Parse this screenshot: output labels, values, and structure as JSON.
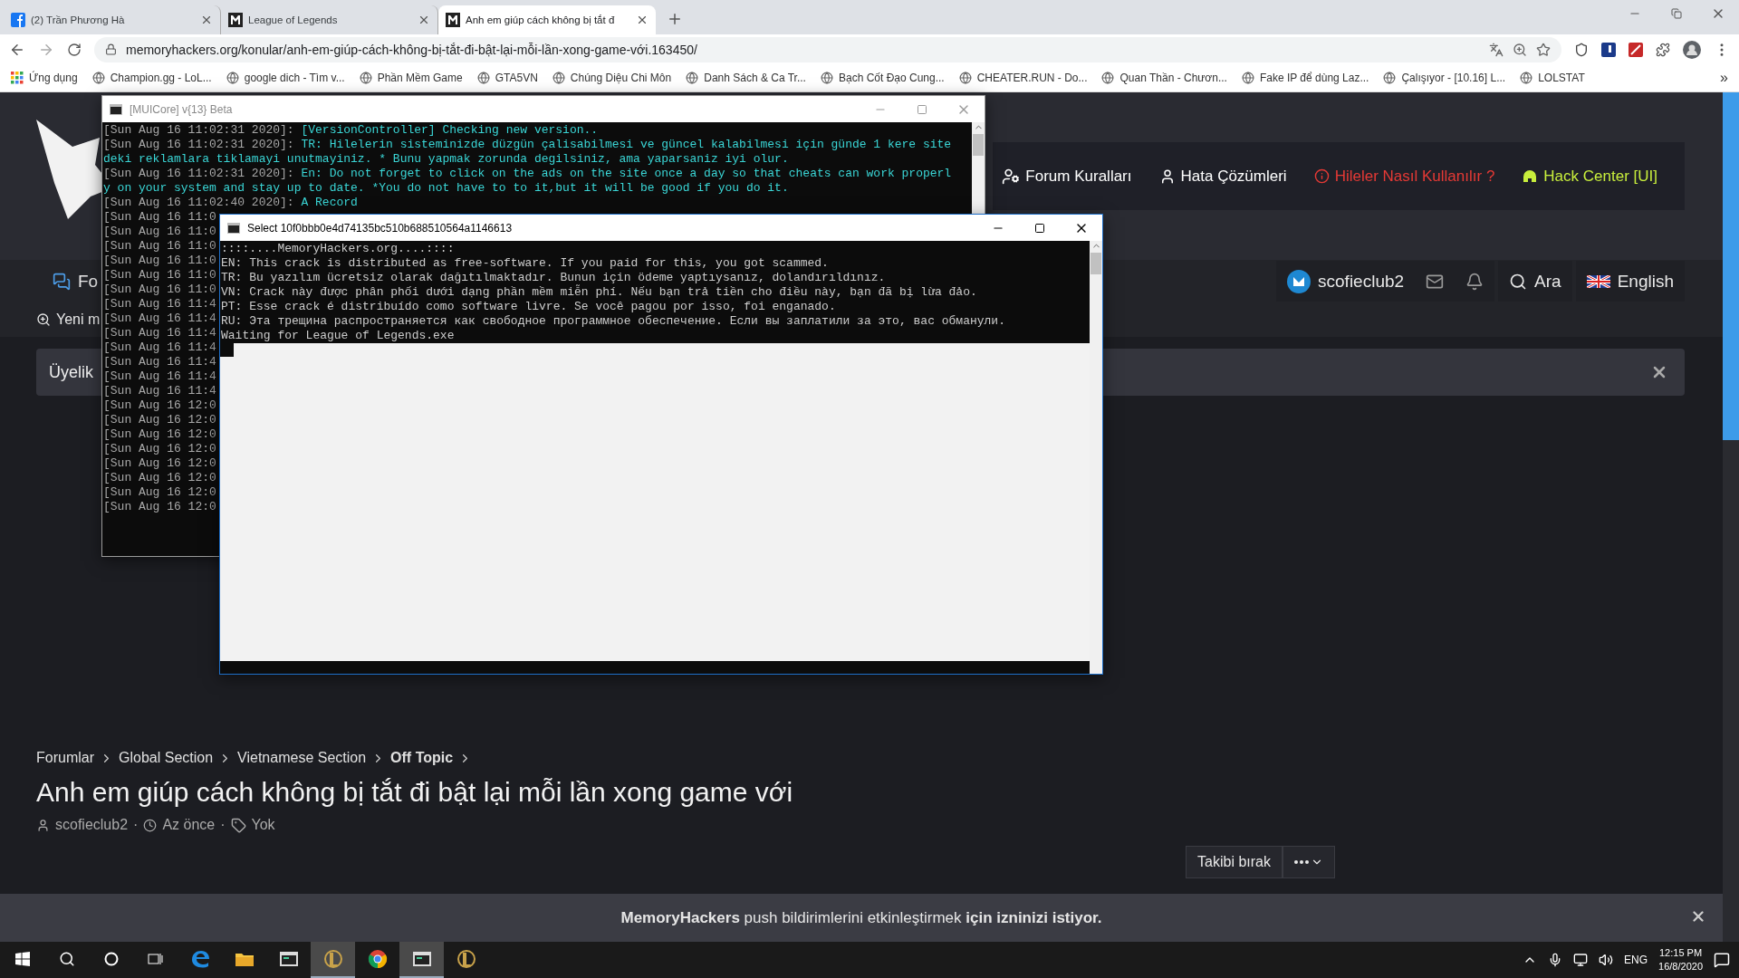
{
  "browser": {
    "tabs": [
      {
        "title": "(2) Trần Phương Hà",
        "kind": "facebook",
        "selected": false
      },
      {
        "title": "League of Legends",
        "kind": "forum",
        "selected": false
      },
      {
        "title": "Anh em giúp cách không bị tắt đ",
        "kind": "forum",
        "selected": true
      }
    ],
    "url": "memoryhackers.org/konular/anh-em-giúp-cách-không-bị-tắt-đi-bật-lại-mỗi-lần-xong-game-với.163450/",
    "apps_label": "Ứng dụng",
    "bookmarks": [
      "Champion.gg - LoL...",
      "google dich - Tìm v...",
      "Phần Mềm Game",
      "GTA5VN",
      "Chúng Diệu Chi Môn",
      "Danh Sách & Ca Tr...",
      "Bạch Cốt Đạo Cung...",
      "CHEATER.RUN - Do...",
      "Quan Thần - Chươn...",
      "Fake IP để dùng Laz...",
      "Çalışıyor - [10.16] L...",
      "LOLSTAT"
    ],
    "bookmarks_more": "»"
  },
  "site": {
    "nav_links": [
      {
        "label": "Forum Kuralları",
        "kind": "rules",
        "color": "#ffffff"
      },
      {
        "label": "Hata Çözümleri",
        "kind": "support",
        "color": "#ffffff"
      },
      {
        "label": "Hileler Nasıl Kullanılır ?",
        "kind": "info",
        "color": "#e53935"
      },
      {
        "label": "Hack Center [UI]",
        "kind": "helmet",
        "color": "#c8ee3c"
      }
    ],
    "forums_tab": "Fo",
    "user": "scofieclub2",
    "search": "Ara",
    "language": "English",
    "sub_nav": "Yeni m",
    "notice": "Üyelik",
    "breadcrumb": [
      {
        "label": "Forumlar",
        "current": false
      },
      {
        "label": "Global Section",
        "current": false
      },
      {
        "label": "Vietnamese Section",
        "current": false
      },
      {
        "label": "Off Topic",
        "current": true
      }
    ],
    "title": "Anh em giúp cách không bị tắt đi bật lại mỗi lần xong game với",
    "meta": {
      "author": "scofieclub2",
      "time": "Az önce",
      "tags": "Yok",
      "separators": [
        "·",
        "·"
      ]
    },
    "unfollow": "Takibi bırak",
    "push": "**MemoryHackers** push bildirimlerini etkinleştirmek **için izninizi istiyor.**"
  },
  "consoles": [
    {
      "title": "[MUICore] v{13} Beta",
      "active": false,
      "lines": [
        {
          "time": "[Sun Aug 16 11:02:31 2020]: ",
          "message": "[VersionController] Checking new version.."
        },
        {
          "time": "[Sun Aug 16 11:02:31 2020]: ",
          "message": "TR: Hilelerin sisteminizde düzgün çalisabilmesi ve güncel kalabilmesi için günde 1 kere sitedeki reklamlara tiklamayi unutmayiniz. * Bunu yapmak zorunda degilsiniz, ama yaparsaniz iyi olur."
        },
        {
          "time": "[Sun Aug 16 11:02:31 2020]: ",
          "message": "En: Do not forget to click on the ads on the site once a day so that cheats can work properly on your system and stay up to date. *You do not have to to it,but it will be good if you do it."
        },
        {
          "time": "[Sun Aug 16 11:02:40 2020]: ",
          "message": "A Record"
        },
        {
          "time": "[Sun Aug 16 11:0"
        },
        {
          "time": "[Sun Aug 16 11:0"
        },
        {
          "time": "[Sun Aug 16 11:0"
        },
        {
          "time": "[Sun Aug 16 11:0"
        },
        {
          "time": "[Sun Aug 16 11:0"
        },
        {
          "time": "[Sun Aug 16 11:0"
        },
        {
          "time": "[Sun Aug 16 11:4"
        },
        {
          "time": "[Sun Aug 16 11:4"
        },
        {
          "time": "[Sun Aug 16 11:4"
        },
        {
          "time": "[Sun Aug 16 11:4"
        },
        {
          "time": "[Sun Aug 16 11:4"
        },
        {
          "time": "[Sun Aug 16 11:4"
        },
        {
          "time": "[Sun Aug 16 11:4"
        },
        {
          "time": "[Sun Aug 16 12:0"
        },
        {
          "time": "[Sun Aug 16 12:0"
        },
        {
          "time": "[Sun Aug 16 12:0"
        },
        {
          "time": "[Sun Aug 16 12:0"
        },
        {
          "time": "[Sun Aug 16 12:0"
        },
        {
          "time": "[Sun Aug 16 12:0"
        },
        {
          "time": "[Sun Aug 16 12:0"
        },
        {
          "time": "[Sun Aug 16 12:0"
        }
      ]
    },
    {
      "title": "Select 10f0bbb0e4d74135bc510b688510564a1146613",
      "active": true,
      "lines": [
        {
          "message": "::::....MemoryHackers.org....::::"
        },
        {
          "message": "EN: This crack is distributed as free-software. If you paid for this, you got scammed."
        },
        {
          "message": "TR: Bu yazılım ücretsiz olarak dağıtılmaktadır. Bunun için ödeme yaptıysanız, dolandırıldınız."
        },
        {
          "message": "VN: Crack này được phân phối dưới dạng phần mềm miễn phí. Nếu bạn trả tiền cho điều này, bạn đã bị lừa đảo."
        },
        {
          "message": "PT: Esse crack é distribuído como software livre. Se você pagou por isso, foi enganado."
        },
        {
          "message": "RU: Эта трещина распространяется как свободное программное обеспечение. Если вы заплатили за это, вас обманули."
        },
        {
          "message": "Waiting for League of Legends.exe"
        }
      ]
    }
  ],
  "taskbar": {
    "apps": [
      {
        "kind": "start",
        "active": false
      },
      {
        "kind": "search",
        "active": false
      },
      {
        "kind": "cortana",
        "active": false
      },
      {
        "kind": "taskview",
        "active": false
      },
      {
        "kind": "edge",
        "active": false
      },
      {
        "kind": "explorer",
        "active": false
      },
      {
        "kind": "window",
        "active": false
      },
      {
        "kind": "lol",
        "active": true
      },
      {
        "kind": "chrome",
        "active": false
      },
      {
        "kind": "window",
        "active": true
      },
      {
        "kind": "lol",
        "active": false
      }
    ],
    "language": "ENG",
    "time": "12:15 PM",
    "date": "16/8/2020"
  }
}
